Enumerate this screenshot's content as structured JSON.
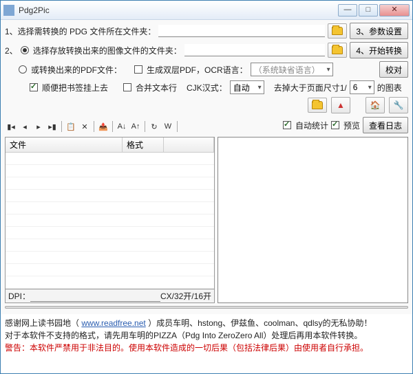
{
  "title": "Pdg2Pic",
  "step1_label": "1、选择需转换的 PDG 文件所在文件夹：",
  "step2_label": "2、",
  "step2_radio": "选择存放转换出来的图像文件的文件夹：",
  "pdf_radio": "或转换出来的PDF文件：",
  "gen_dual_pdf": "生成双层PDF，OCR语言：",
  "ocr_lang": "（系统缺省语言）",
  "bookmark_check": "顺便把书签挂上去",
  "merge_text": "合并文本行",
  "cjk_label": "CJK汉式：",
  "cjk_value": "自动",
  "remove_label": "去掉大于页面尺寸1/",
  "remove_value": "6",
  "remove_suffix": "的图表",
  "btn3": "3、参数设置",
  "btn4": "4、开始转换",
  "btn_verify": "校对",
  "auto_stats": "自动统计",
  "preview": "预览",
  "view_log": "查看日志",
  "table": {
    "col_file": "文件",
    "col_format": "格式"
  },
  "dpi_label": "DPI：",
  "dpi_suffix": "CX/32开/16开",
  "footer_line1a": "感谢网上读书园地（",
  "footer_link": "www.readfree.net",
  "footer_line1b": "）成员车明、hstong、伊兹鱼、coolman、qdlsy的无私协助！",
  "footer_line2": "对于本软件不支持的格式，请先用车明的PIZZA（Pdg Into ZeroZero All）处理后再用本软件转换。",
  "footer_warning": "警告：本软件严禁用于非法目的。使用本软件造成的一切后果（包括法律后果）由使用者自行承担。"
}
